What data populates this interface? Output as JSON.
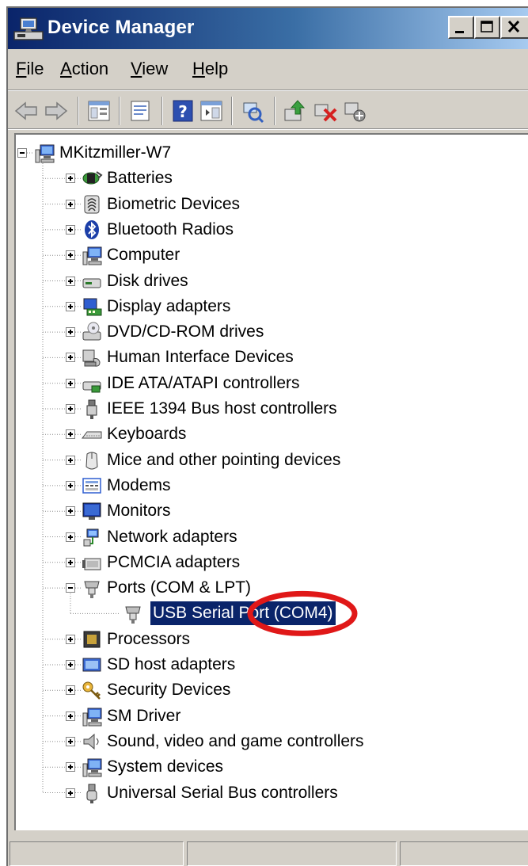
{
  "window": {
    "title": "Device Manager",
    "icon": "device-manager-icon",
    "controls": [
      "minimize-icon",
      "maximize-icon",
      "close-icon"
    ]
  },
  "menu": [
    {
      "label": "File",
      "accel": "F",
      "rest": "ile"
    },
    {
      "label": "Action",
      "accel": "A",
      "rest": "ction"
    },
    {
      "label": "View",
      "accel": "V",
      "rest": "iew"
    },
    {
      "label": "Help",
      "accel": "H",
      "rest": "elp"
    }
  ],
  "toolbar": [
    "back-arrow-icon",
    "forward-arrow-icon",
    "show-hide-console-tree-icon",
    "properties-icon",
    "help-icon",
    "show-action-pane-icon",
    "scan-hardware-changes-icon",
    "update-driver-icon",
    "uninstall-device-icon",
    "disable-device-icon"
  ],
  "tree": {
    "root": {
      "label": "MKitzmiller-W7",
      "icon": "computer-icon",
      "expanded": true
    },
    "categories": [
      {
        "label": "Batteries",
        "icon": "battery-icon",
        "expanded": false
      },
      {
        "label": "Biometric Devices",
        "icon": "fingerprint-icon",
        "expanded": false
      },
      {
        "label": "Bluetooth Radios",
        "icon": "bluetooth-icon",
        "expanded": false
      },
      {
        "label": "Computer",
        "icon": "computer-icon",
        "expanded": false
      },
      {
        "label": "Disk drives",
        "icon": "disk-drive-icon",
        "expanded": false
      },
      {
        "label": "Display adapters",
        "icon": "display-adapter-icon",
        "expanded": false
      },
      {
        "label": "DVD/CD-ROM drives",
        "icon": "dvd-drive-icon",
        "expanded": false
      },
      {
        "label": "Human Interface Devices",
        "icon": "hid-icon",
        "expanded": false
      },
      {
        "label": "IDE ATA/ATAPI controllers",
        "icon": "ide-controller-icon",
        "expanded": false
      },
      {
        "label": "IEEE 1394 Bus host controllers",
        "icon": "firewire-icon",
        "expanded": false
      },
      {
        "label": "Keyboards",
        "icon": "keyboard-icon",
        "expanded": false
      },
      {
        "label": "Mice and other pointing devices",
        "icon": "mouse-icon",
        "expanded": false
      },
      {
        "label": "Modems",
        "icon": "modem-icon",
        "expanded": false
      },
      {
        "label": "Monitors",
        "icon": "monitor-icon",
        "expanded": false
      },
      {
        "label": "Network adapters",
        "icon": "network-adapter-icon",
        "expanded": false
      },
      {
        "label": "PCMCIA adapters",
        "icon": "pcmcia-icon",
        "expanded": false
      },
      {
        "label": "Ports (COM & LPT)",
        "icon": "port-icon",
        "expanded": true,
        "children": [
          {
            "label": "USB Serial Port (COM4)",
            "icon": "port-icon",
            "selected": true
          }
        ]
      },
      {
        "label": "Processors",
        "icon": "processor-icon",
        "expanded": false
      },
      {
        "label": "SD host adapters",
        "icon": "sd-adapter-icon",
        "expanded": false
      },
      {
        "label": "Security Devices",
        "icon": "security-key-icon",
        "expanded": false
      },
      {
        "label": "SM Driver",
        "icon": "computer-icon",
        "expanded": false
      },
      {
        "label": "Sound, video and game controllers",
        "icon": "speaker-icon",
        "expanded": false
      },
      {
        "label": "System devices",
        "icon": "computer-icon",
        "expanded": false
      },
      {
        "label": "Universal Serial Bus controllers",
        "icon": "usb-icon",
        "expanded": false
      }
    ]
  },
  "annotation": {
    "shape": "ellipse",
    "color": "#e01818",
    "target": "USB Serial Port (COM4)"
  },
  "colors": {
    "selection": "#0a246a",
    "titlebar_start": "#0a246a",
    "titlebar_end": "#a6caf0",
    "chrome": "#d4d0c8"
  }
}
